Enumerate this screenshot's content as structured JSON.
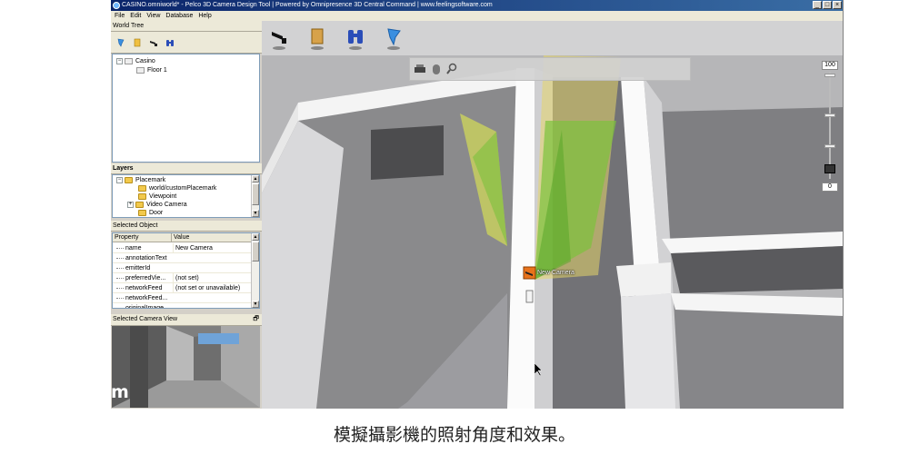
{
  "window": {
    "title": "CASINO.omniworld* - Pelco 3D Camera Design Tool | Powered by Omnipresence 3D Central Command | www.feelingsoftware.com",
    "minimize": "_",
    "maximize": "□",
    "close": "×"
  },
  "menu": [
    "File",
    "Edit",
    "View",
    "Database",
    "Help"
  ],
  "world_tree": {
    "header": "World Tree",
    "toolbar_icons": [
      "zone-icon",
      "sign-icon",
      "camera-icon",
      "binoculars-icon"
    ],
    "items": [
      {
        "label": "Casino",
        "expander": "−"
      },
      {
        "label": "Floor 1"
      }
    ]
  },
  "layers": {
    "header": "Layers",
    "items": [
      {
        "label": "Placemark",
        "expander": "−"
      },
      {
        "label": "world/customPlacemark"
      },
      {
        "label": "Viewpoint"
      },
      {
        "label": "Video Camera",
        "expander": "+"
      },
      {
        "label": "Door"
      }
    ]
  },
  "selected_object": {
    "header": "Selected Object",
    "columns": [
      "Property",
      "Value"
    ],
    "rows": [
      {
        "name": "name",
        "value": "New Camera"
      },
      {
        "name": "annotationText",
        "value": ""
      },
      {
        "name": "emitterId",
        "value": ""
      },
      {
        "name": "preferredVie...",
        "value": "(not set)"
      },
      {
        "name": "networkFeed",
        "value": "(not set or unavailable)"
      },
      {
        "name": "networkFeed...",
        "value": ""
      },
      {
        "name": "originalImage",
        "value": ""
      }
    ]
  },
  "camera_view": {
    "header": "Selected Camera View",
    "pin": "🗗"
  },
  "viewport": {
    "toolbar_icons": [
      "camera-icon",
      "sign-icon",
      "binoculars-icon",
      "zone-icon"
    ],
    "sub_icons": [
      "printer-icon",
      "mouse-icon",
      "zoom-icon"
    ],
    "zoom_top": "100",
    "zoom_bottom": "0",
    "camera_label": "New Camera"
  },
  "watermark": "m",
  "caption": "模擬攝影機的照射角度和效果。",
  "colors": {
    "titlebar": "#0a246a",
    "cone_green": "#7cc23c",
    "cone_yellow": "#e6d66a",
    "camera_orange": "#e8731c"
  }
}
